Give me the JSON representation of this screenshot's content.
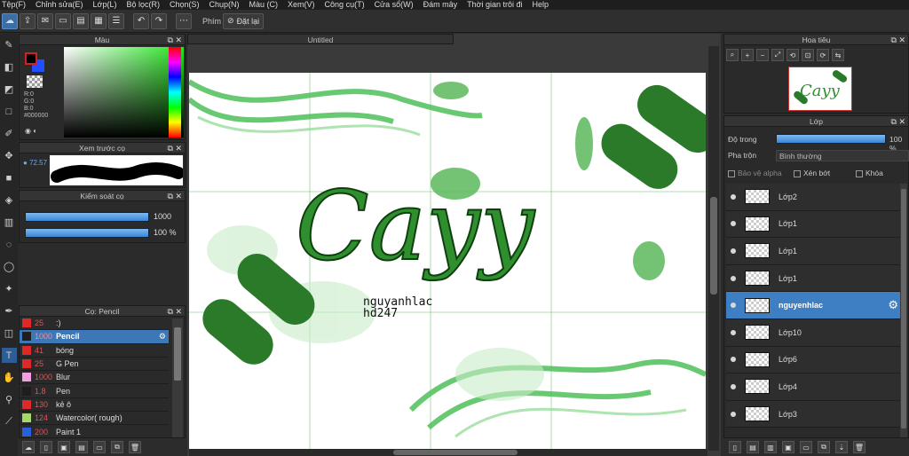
{
  "menu": [
    "Tệp(F)",
    "Chỉnh sửa(E)",
    "Lớp(L)",
    "Bộ lọc(R)",
    "Chọn(S)",
    "Chụp(N)",
    "Màu (C)",
    "Xem(V)",
    "Công cụ(T)",
    "Cửa sổ(W)",
    "Đám mây",
    "Thời gian trôi đi",
    "Help"
  ],
  "toolbar": {
    "snap_label": "Phím",
    "reset_label": "Đặt lại"
  },
  "color_panel": {
    "title": "Màu",
    "r": "R:0",
    "g": "G:0",
    "b": "B:0",
    "hex": "#000000",
    "foreground": "#000000",
    "background": "#1f4fff",
    "hue": "#25e620"
  },
  "preview_panel": {
    "title": "Xem trước cọ",
    "size": "72.57"
  },
  "brush_control": {
    "title": "Kiểm soát cọ",
    "size_value": "1000",
    "opacity_value": "100 %"
  },
  "brush_list": {
    "title": "Cọ: Pencil",
    "items": [
      {
        "color": "#e02828",
        "size": "25",
        "name": ":)"
      },
      {
        "color": "#1e1e1e",
        "size": "1000",
        "name": "Pencil",
        "selected": true
      },
      {
        "color": "#e02828",
        "size": "41",
        "name": "bóng"
      },
      {
        "color": "#e02828",
        "size": "25",
        "name": "G Pen"
      },
      {
        "color": "#f2a0e0",
        "size": "1000",
        "name": "Blur"
      },
      {
        "color": "#1e1e1e",
        "size": "1.8",
        "name": "Pen"
      },
      {
        "color": "#e02828",
        "size": "130",
        "name": "kẻ ô"
      },
      {
        "color": "#a6d86a",
        "size": "124",
        "name": "Watercolor( rough)"
      },
      {
        "color": "#2a5fe0",
        "size": "200",
        "name": "Paint 1"
      }
    ]
  },
  "canvas": {
    "tab_title": "Untitled",
    "art_text": "Cayy",
    "signature_line1": "nguyanhlac",
    "signature_line2": "hd247"
  },
  "navigator": {
    "title": "Hoa tiêu",
    "thumb_text": "Cayy"
  },
  "layer_panel": {
    "title": "Lớp",
    "opacity_label": "Độ trong",
    "opacity_value": "100 %",
    "blend_label": "Pha trộn",
    "blend_value": "Bình thường",
    "protect_alpha": "Bảo vệ alpha",
    "clipping": "Xén bớt",
    "lock": "Khóa",
    "layers": [
      {
        "name": "Lớp2"
      },
      {
        "name": "Lớp1"
      },
      {
        "name": "Lớp1"
      },
      {
        "name": "Lớp1"
      },
      {
        "name": "nguyenhlac",
        "selected": true
      },
      {
        "name": "Lớp10"
      },
      {
        "name": "Lớp6"
      },
      {
        "name": "Lớp4"
      },
      {
        "name": "Lớp3"
      }
    ]
  }
}
